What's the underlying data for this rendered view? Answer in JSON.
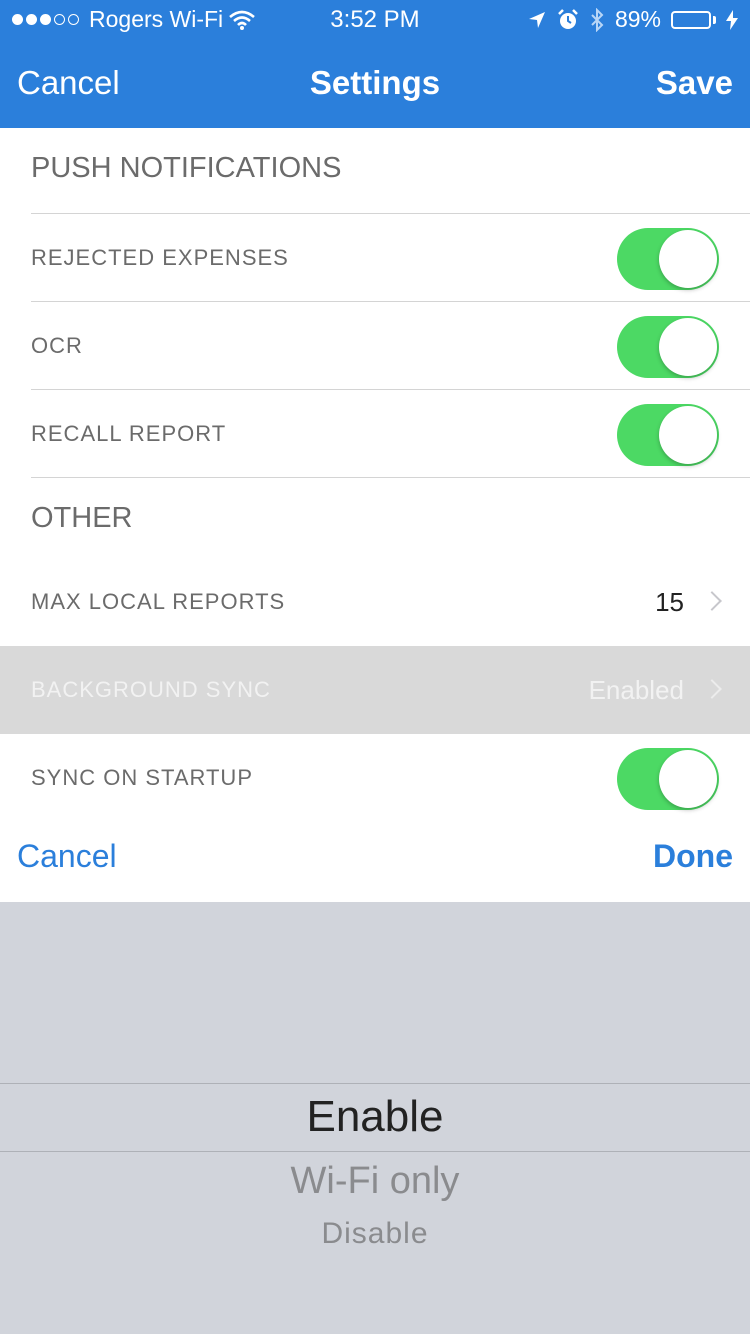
{
  "status_bar": {
    "carrier": "Rogers Wi-Fi",
    "time": "3:52 PM",
    "battery": "89%",
    "battery_level": 0.89
  },
  "nav": {
    "cancel_label": "Cancel",
    "title": "Settings",
    "save_label": "Save"
  },
  "sections": {
    "push_notifications": "PUSH NOTIFICATIONS",
    "other": "OTHER"
  },
  "rows": {
    "rejected_expenses": {
      "label": "REJECTED EXPENSES",
      "on": true
    },
    "ocr": {
      "label": "OCR",
      "on": true
    },
    "recall_report": {
      "label": "RECALL REPORT",
      "on": true
    },
    "max_local_reports": {
      "label": "MAX LOCAL REPORTS",
      "value": "15"
    },
    "background_sync": {
      "label": "BACKGROUND SYNC",
      "value": "Enabled"
    },
    "sync_on_startup": {
      "label": "SYNC ON STARTUP",
      "on": true
    }
  },
  "picker_toolbar": {
    "cancel_label": "Cancel",
    "done_label": "Done"
  },
  "picker": {
    "options": [
      "Enable",
      "Wi-Fi only",
      "Disable"
    ],
    "selected": "Enable"
  },
  "colors": {
    "nav_blue": "#2b7fdb",
    "toggle_green": "#4cd964",
    "picker_bg": "#d1d4db"
  }
}
